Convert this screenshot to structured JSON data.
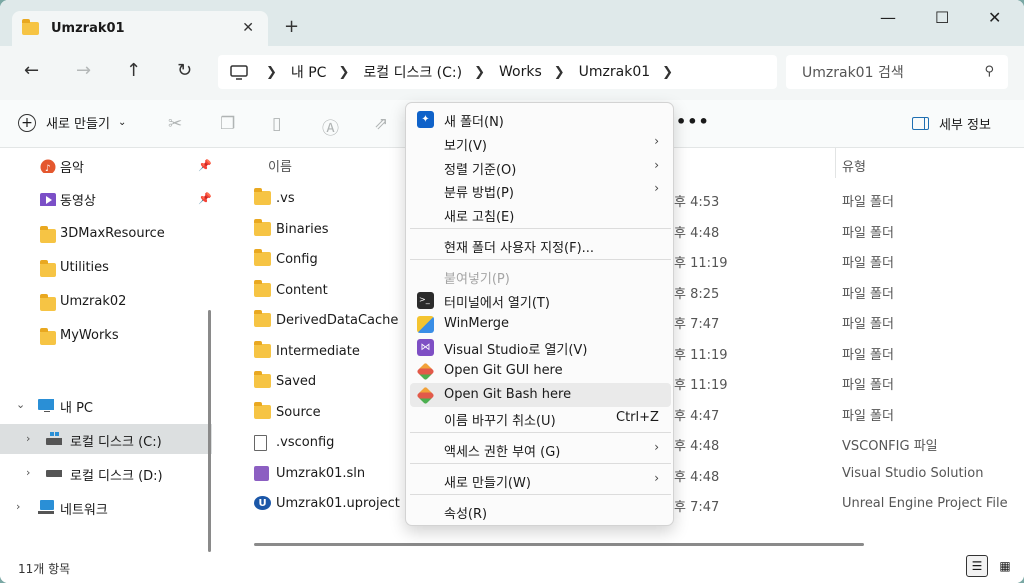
{
  "window": {
    "tab_title": "Umzrak01",
    "tab_close": "✕",
    "new_tab": "+",
    "minimize": "—",
    "maximize": "☐",
    "close": "✕"
  },
  "address": {
    "crumbs": [
      "내 PC",
      "로컬 디스크 (C:)",
      "Works",
      "Umzrak01"
    ],
    "search_placeholder": "Umzrak01 검색"
  },
  "commandbar": {
    "new_label": "새로 만들기",
    "more": "•••",
    "details_label": "세부 정보"
  },
  "sidebar": {
    "items": [
      {
        "label": "음악"
      },
      {
        "label": "동영상"
      },
      {
        "label": "3DMaxResource"
      },
      {
        "label": "Utilities"
      },
      {
        "label": "Umzrak02"
      },
      {
        "label": "MyWorks"
      },
      {
        "label": "내 PC"
      },
      {
        "label": "로컬 디스크 (C:)"
      },
      {
        "label": "로컬 디스크 (D:)"
      },
      {
        "label": "네트워크"
      }
    ]
  },
  "filelist": {
    "col_name": "이름",
    "col_type": "유형",
    "rows": [
      {
        "name": ".vs",
        "date": "후 4:53",
        "type": "파일 폴더"
      },
      {
        "name": "Binaries",
        "date": "후 4:48",
        "type": "파일 폴더"
      },
      {
        "name": "Config",
        "date": "후 11:19",
        "type": "파일 폴더"
      },
      {
        "name": "Content",
        "date": "후 8:25",
        "type": "파일 폴더"
      },
      {
        "name": "DerivedDataCache",
        "date": "후 7:47",
        "type": "파일 폴더"
      },
      {
        "name": "Intermediate",
        "date": "후 11:19",
        "type": "파일 폴더"
      },
      {
        "name": "Saved",
        "date": "후 11:19",
        "type": "파일 폴더"
      },
      {
        "name": "Source",
        "date": "후 4:47",
        "type": "파일 폴더"
      },
      {
        "name": ".vsconfig",
        "date": "후 4:48",
        "type": "VSCONFIG 파일"
      },
      {
        "name": "Umzrak01.sln",
        "date": "후 4:48",
        "type": "Visual Studio Solution"
      },
      {
        "name": "Umzrak01.uproject",
        "date": "후 7:47",
        "type": "Unreal Engine Project File"
      }
    ]
  },
  "status": {
    "count": "11개 항목"
  },
  "context_menu": {
    "new_folder": "새 폴더(N)",
    "view": "보기(V)",
    "sort_by": "정렬 기준(O)",
    "group_by": "분류 방법(P)",
    "refresh": "새로 고침(E)",
    "customize": "현재 폴더 사용자 지정(F)...",
    "paste": "붙여넣기(P)",
    "open_terminal": "터미널에서 열기(T)",
    "winmerge": "WinMerge",
    "open_vs": "Visual Studio로 열기(V)",
    "git_gui": "Open Git GUI here",
    "git_bash": "Open Git Bash here",
    "undo_rename": "이름 바꾸기 취소(U)",
    "undo_shortcut": "Ctrl+Z",
    "access": "액세스 권한 부여 (G)",
    "new": "새로 만들기(W)",
    "properties": "속성(R)"
  }
}
